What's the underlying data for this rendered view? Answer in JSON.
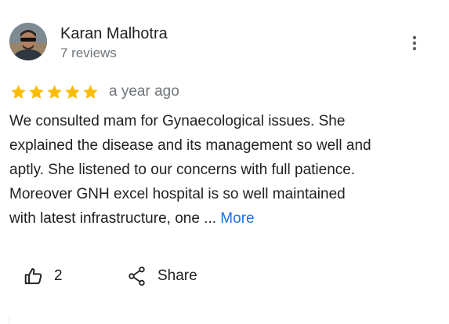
{
  "reviewer": {
    "name": "Karan Malhotra",
    "meta": "7 reviews"
  },
  "rating": {
    "stars": 5,
    "max_stars": 5,
    "star_color": "#fbbc04",
    "date": "a year ago"
  },
  "review": {
    "lines": [
      "We consulted mam for Gynaecological issues. She",
      "explained the disease and its management so well and",
      "aptly. She listened to our concerns with full patience.",
      "Moreover GNH excel hospital is so well maintained",
      "with latest infrastructure, one ..."
    ],
    "more_label": "More",
    "link_color": "#1a73e8"
  },
  "actions": {
    "like_count": "2",
    "share_label": "Share"
  },
  "icons": {
    "avatar": "avatar",
    "more_options": "more-vert-icon",
    "like": "thumb-up-icon",
    "share": "share-icon",
    "star": "star-icon"
  }
}
